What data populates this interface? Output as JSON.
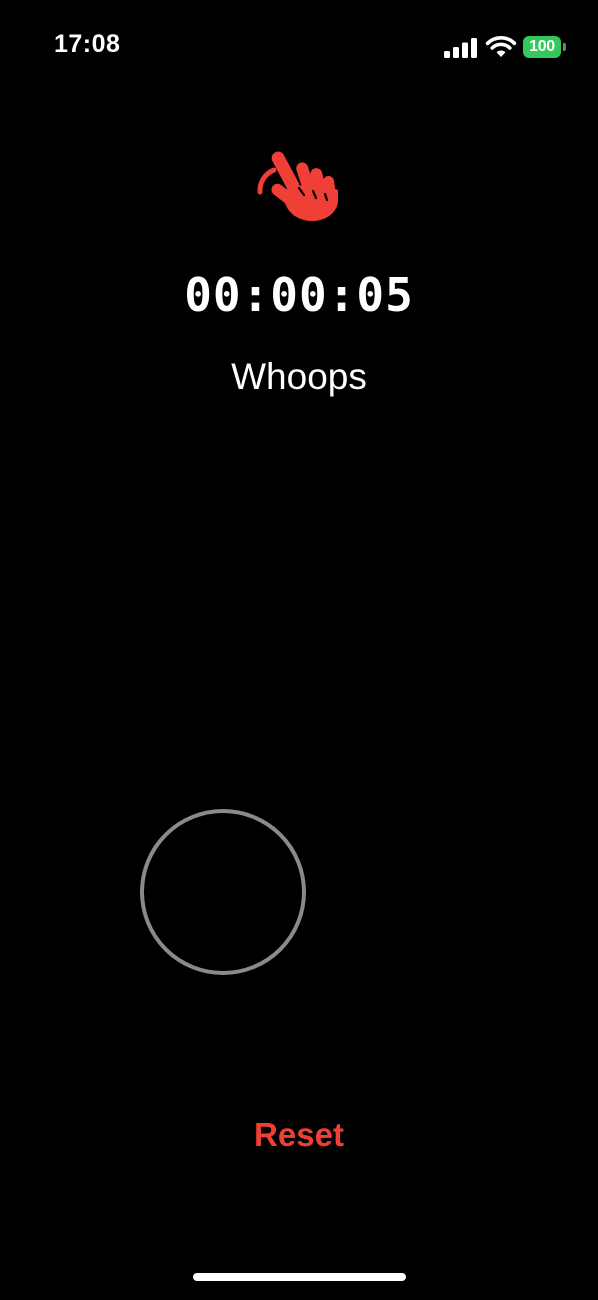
{
  "status_bar": {
    "time": "17:08",
    "battery_level": "100",
    "icons": [
      "signal-icon",
      "wifi-icon",
      "battery-icon"
    ]
  },
  "main": {
    "icon": "tap-hand-icon",
    "timer": "00:00:05",
    "message": "Whoops"
  },
  "actions": {
    "reset_label": "Reset"
  },
  "colors": {
    "background": "#000000",
    "text": "#ffffff",
    "accent": "#ef3f36",
    "battery": "#34c759",
    "circle_outline": "#8a8a8a"
  }
}
